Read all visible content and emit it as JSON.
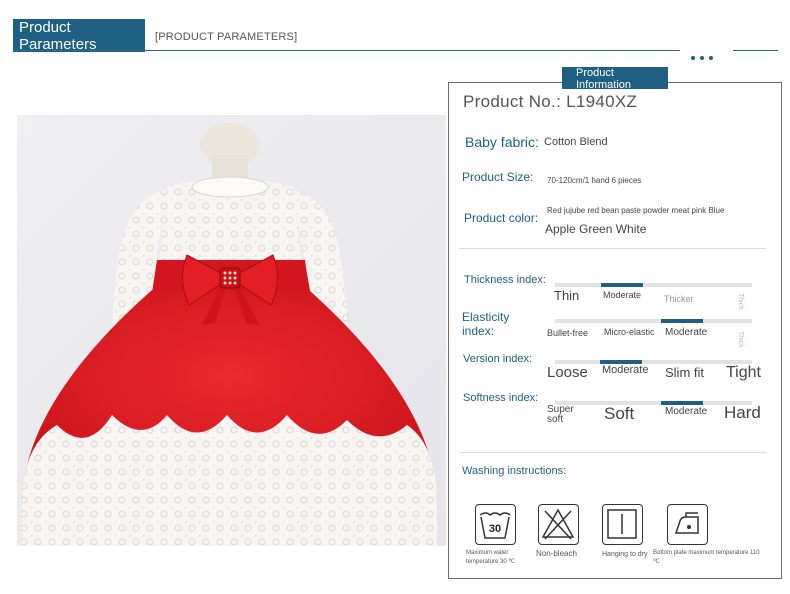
{
  "header": {
    "tab_line1": "Product",
    "tab_line2": "Parameters",
    "subtitle": "[PRODUCT PARAMETERS]"
  },
  "panel": {
    "tab_line1": "Product",
    "tab_line2": "Information",
    "product_no": "Product No.: L1940XZ",
    "fabric_label": "Baby fabric:",
    "fabric_value": "Cotton Blend",
    "size_label": "Product Size:",
    "size_value": "70-120cm/1 hand 6 pieces",
    "color_label": "Product color:",
    "color_value_line1": "Red jujube red bean paste powder meat pink Blue",
    "color_value_line2": "Apple Green White"
  },
  "indices": {
    "thickness": {
      "label": "Thickness index:",
      "options": [
        "Thin",
        "Moderate",
        "Thicker",
        "Thick"
      ],
      "selected": "Moderate"
    },
    "elasticity": {
      "label_line1": "Elasticity",
      "label_line2": "index:",
      "options": [
        "Bullet-free",
        "Micro-elastic",
        "Moderate",
        "Thick"
      ],
      "selected": "Moderate"
    },
    "version": {
      "label": "Version index:",
      "options": [
        "Loose",
        "Moderate",
        "Slim fit",
        "Tight"
      ],
      "selected": "Moderate"
    },
    "softness": {
      "label": "Softness index:",
      "options_line1": [
        "Super",
        "Soft",
        "Moderate",
        "Hard"
      ],
      "option_super_line2": "soft",
      "selected": "Moderate"
    }
  },
  "washing": {
    "label": "Washing instructions:",
    "icons": [
      {
        "name": "wash-30-icon",
        "symbol": "30",
        "caption_line1": "Maximum water",
        "caption_line2": "temperature 30 ℃"
      },
      {
        "name": "no-bleach-icon",
        "caption_line1": "Non-bleach",
        "caption_line2": ""
      },
      {
        "name": "hang-dry-icon",
        "caption_line1": "Hanging to dry",
        "caption_line2": ""
      },
      {
        "name": "iron-icon",
        "caption_line1": "Bottom plate maximum temperature 110",
        "caption_line2": "℃"
      }
    ]
  },
  "colors": {
    "accent": "#1f5f82",
    "dress_red": "#d8141c",
    "lace_white": "#f7f4f2"
  }
}
